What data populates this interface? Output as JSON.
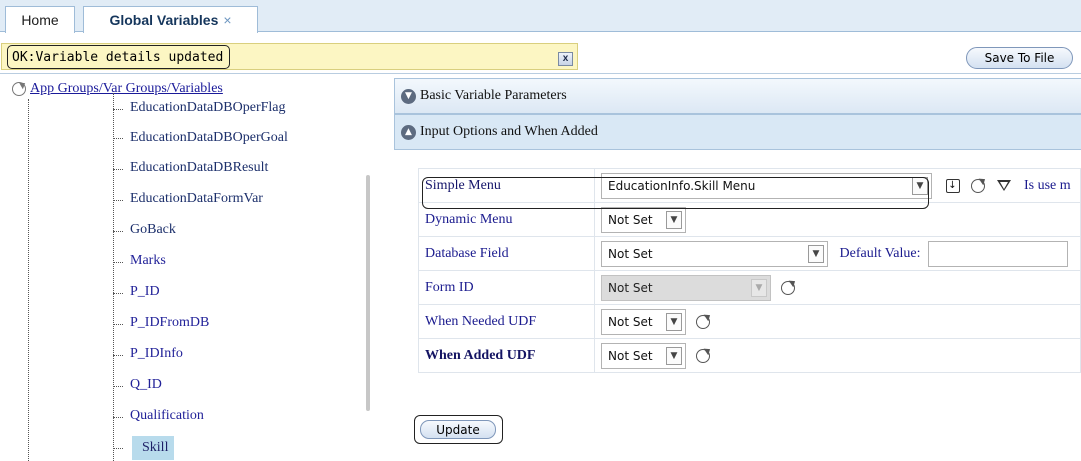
{
  "tabs": {
    "home": "Home",
    "global": "Global Variables",
    "close_glyph": "×"
  },
  "status": {
    "message": "OK:Variable details updated",
    "close_glyph": "x"
  },
  "toolbar": {
    "save_label": "Save To File"
  },
  "tree": {
    "root_label": "App Groups/Var Groups/Variables",
    "items": [
      {
        "label": "EducationDataDBOperFlag"
      },
      {
        "label": "EducationDataDBOperGoal"
      },
      {
        "label": "EducationDataDBResult"
      },
      {
        "label": "EducationDataFormVar"
      },
      {
        "label": "GoBack"
      },
      {
        "label": "Marks"
      },
      {
        "label": "P_ID"
      },
      {
        "label": "P_IDFromDB"
      },
      {
        "label": "P_IDInfo"
      },
      {
        "label": "Q_ID"
      },
      {
        "label": "Qualification"
      },
      {
        "label": "Skill"
      }
    ],
    "selected": "Skill"
  },
  "panels": {
    "basic": "Basic Variable Parameters",
    "input": "Input Options and When Added"
  },
  "form": {
    "simple_menu": {
      "label": "Simple Menu",
      "value": "EducationInfo.Skill Menu",
      "help": "Is use m"
    },
    "dynamic_menu": {
      "label": "Dynamic Menu",
      "value": "Not Set"
    },
    "database_field": {
      "label": "Database Field",
      "value": "Not Set",
      "default_label": "Default Value:",
      "default_value": ""
    },
    "form_id": {
      "label": "Form ID",
      "value": "Not Set"
    },
    "when_needed": {
      "label": "When Needed UDF",
      "value": "Not Set"
    },
    "when_added": {
      "label": "When Added UDF",
      "value": "Not Set"
    },
    "update_label": "Update"
  },
  "colors": {
    "status_bg": "#fcf6c3",
    "selected_bg": "#b8dbec",
    "label_blue": "#1a1a8e"
  }
}
